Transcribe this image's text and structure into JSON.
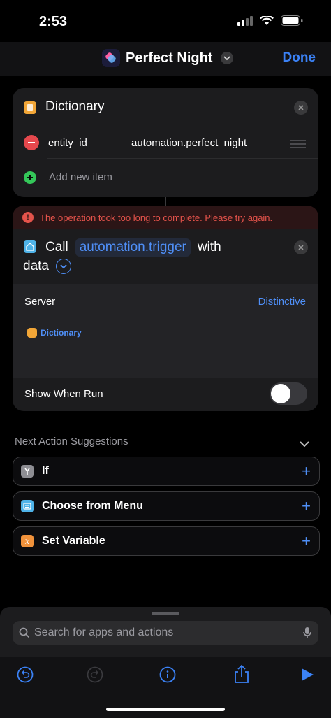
{
  "status": {
    "time": "2:53"
  },
  "nav": {
    "title": "Perfect Night",
    "done_label": "Done"
  },
  "dictionary": {
    "title": "Dictionary",
    "rows": [
      {
        "key": "entity_id",
        "value": "automation.perfect_night"
      }
    ],
    "add_label": "Add new item"
  },
  "error": {
    "message": "The operation took too long to complete. Please try again."
  },
  "call_action": {
    "call_label": "Call",
    "service": "automation.trigger",
    "with_label": "with",
    "data_label": "data",
    "server_label": "Server",
    "server_value": "Distinctive",
    "dictionary_chip": "Dictionary",
    "show_when_run_label": "Show When Run",
    "show_when_run": false
  },
  "suggestions": {
    "header": "Next Action Suggestions",
    "items": [
      {
        "label": "If",
        "icon": "branch-icon",
        "color": "#8e8e93"
      },
      {
        "label": "Choose from Menu",
        "icon": "menu-icon",
        "color": "#4fb3e8"
      },
      {
        "label": "Set Variable",
        "icon": "variable-icon",
        "color": "#f0923b"
      }
    ]
  },
  "search": {
    "placeholder": "Search for apps and actions"
  },
  "colors": {
    "accent": "#3b82f6",
    "error": "#e5534b",
    "background": "#000000",
    "card": "#1c1c1e"
  }
}
